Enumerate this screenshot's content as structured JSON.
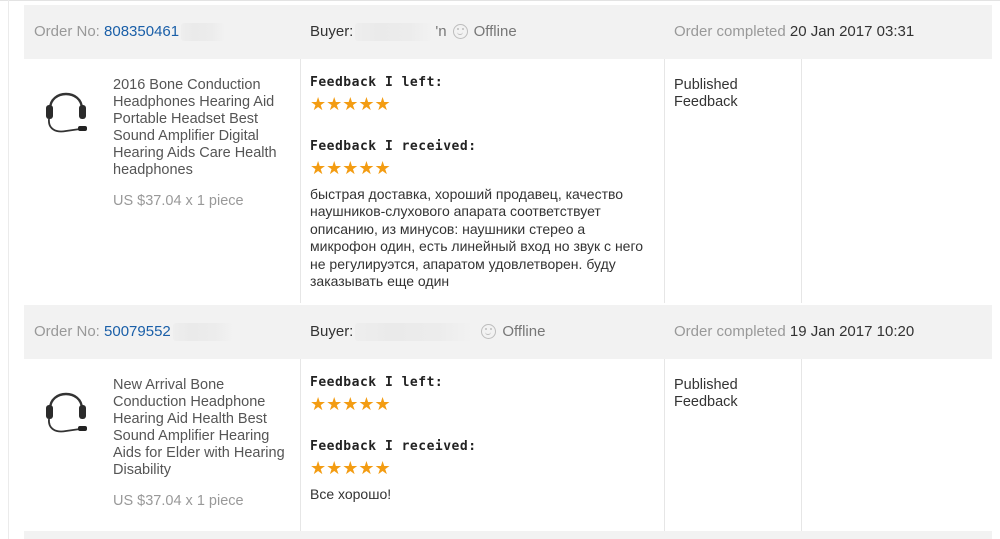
{
  "orders": [
    {
      "order_no_label": "Order No:",
      "order_no": "808350461",
      "buyer_label": "Buyer:",
      "buyer_suffix": "'n",
      "status": "Offline",
      "completed_label": "Order completed",
      "completed_date": "20 Jan 2017 03:31",
      "product_title": "2016 Bone Conduction Headphones Hearing Aid Portable Headset Best Sound Amplifier Digital Hearing Aids Care Health headphones",
      "price": "US $37.04 x 1 piece",
      "feedback_left_label": "Feedback I left:",
      "feedback_left_stars": "★★★★★",
      "feedback_received_label": "Feedback I received:",
      "feedback_received_stars": "★★★★★",
      "comment": "быстрая доставка, хороший продавец, качество наушников-слухового апарата соответствует описанию, из минусов: наушники стерео а микрофон один, есть линейный вход но звук с него не регулируэтся, апаратом удовлетворен. буду заказывать еще один",
      "published": "Published Feedback"
    },
    {
      "order_no_label": "Order No:",
      "order_no": "50079552",
      "buyer_label": "Buyer:",
      "buyer_suffix": "",
      "status": "Offline",
      "completed_label": "Order completed",
      "completed_date": "19 Jan 2017 10:20",
      "product_title": "New Arrival Bone Conduction Headphone Hearing Aid Health Best Sound Amplifier Hearing Aids for Elder with Hearing Disability",
      "price": "US $37.04 x 1 piece",
      "feedback_left_label": "Feedback I left:",
      "feedback_left_stars": "★★★★★",
      "feedback_received_label": "Feedback I received:",
      "feedback_received_stars": "★★★★★",
      "comment": "Все хорошо!",
      "published": "Published Feedback"
    }
  ],
  "colors": {
    "star": "#f39c12",
    "link": "#1a5fa8",
    "header_bg": "#f2f2f2"
  },
  "icons": {
    "status": "offline-smiley-icon",
    "product": "headset-icon"
  }
}
